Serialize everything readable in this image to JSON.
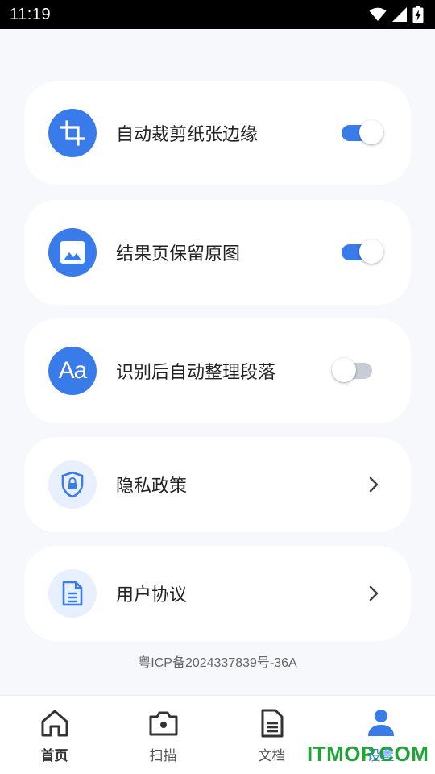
{
  "status_bar": {
    "time": "11:19",
    "icons": [
      "wifi-icon",
      "signal-icon",
      "battery-charging-icon"
    ]
  },
  "settings": {
    "auto_crop": {
      "label": "自动裁剪纸张边缘",
      "icon": "crop-icon",
      "enabled": true
    },
    "keep_original": {
      "label": "结果页保留原图",
      "icon": "image-icon",
      "enabled": true
    },
    "auto_paragraph": {
      "label": "识别后自动整理段落",
      "icon": "text-format-icon",
      "enabled": false
    },
    "privacy_policy": {
      "label": "隐私政策",
      "icon": "shield-lock-icon"
    },
    "user_agreement": {
      "label": "用户协议",
      "icon": "document-icon"
    }
  },
  "footer": {
    "icp": "粤ICP备2024337839号-36A"
  },
  "bottom_nav": {
    "items": [
      {
        "label": "首页",
        "icon": "home-icon"
      },
      {
        "label": "扫描",
        "icon": "camera-icon"
      },
      {
        "label": "文档",
        "icon": "document-icon"
      },
      {
        "label": "设置",
        "icon": "user-icon",
        "selected": true
      }
    ]
  },
  "watermark": {
    "text": "ITMOP.COM"
  },
  "colors": {
    "accent": "#3a7bea",
    "background": "#f7f8fc",
    "card": "#ffffff",
    "watermark": "#22a33a"
  }
}
